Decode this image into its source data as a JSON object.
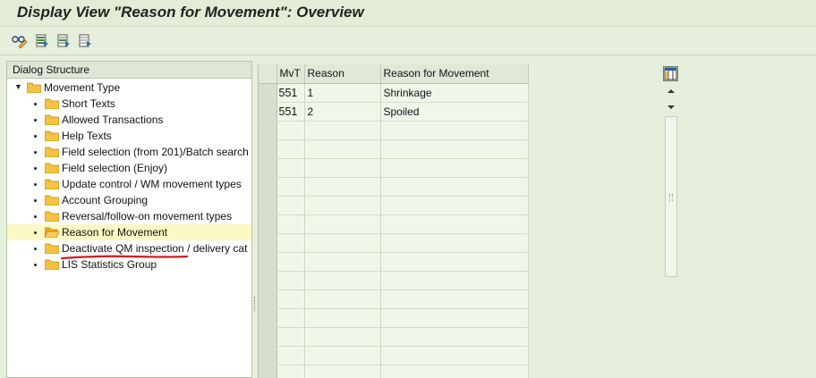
{
  "window": {
    "title": "Display View \"Reason for Movement\": Overview"
  },
  "toolbar": {
    "buttons": [
      {
        "name": "change-display-button",
        "icon": "glasses-pencil-icon"
      },
      {
        "name": "select-all-button",
        "icon": "select-all-icon"
      },
      {
        "name": "select-block-button",
        "icon": "select-block-icon"
      },
      {
        "name": "deselect-all-button",
        "icon": "deselect-all-icon"
      }
    ]
  },
  "dialog_structure": {
    "header": "Dialog Structure",
    "root": {
      "label": "Movement Type",
      "expanded": true
    },
    "items": [
      {
        "label": "Short Texts"
      },
      {
        "label": "Allowed Transactions"
      },
      {
        "label": "Help Texts"
      },
      {
        "label": "Field selection (from 201)/Batch search"
      },
      {
        "label": "Field selection (Enjoy)"
      },
      {
        "label": "Update control / WM movement types"
      },
      {
        "label": "Account Grouping"
      },
      {
        "label": "Reversal/follow-on movement types"
      },
      {
        "label": "Reason for Movement",
        "selected": true
      },
      {
        "label": "Deactivate QM inspection / delivery cat"
      },
      {
        "label": "LIS Statistics Group"
      }
    ]
  },
  "table": {
    "columns": [
      "MvT",
      "Reason",
      "Reason for Movement"
    ],
    "rows": [
      [
        "551",
        "1",
        "Shrinkage"
      ],
      [
        "551",
        "2",
        "Spoiled"
      ]
    ],
    "empty_rows": 14
  },
  "colors": {
    "background": "#e6efdb",
    "folder": "#f5c242",
    "selected_row": "#fbf8c4",
    "annotation": "#d9191c"
  }
}
